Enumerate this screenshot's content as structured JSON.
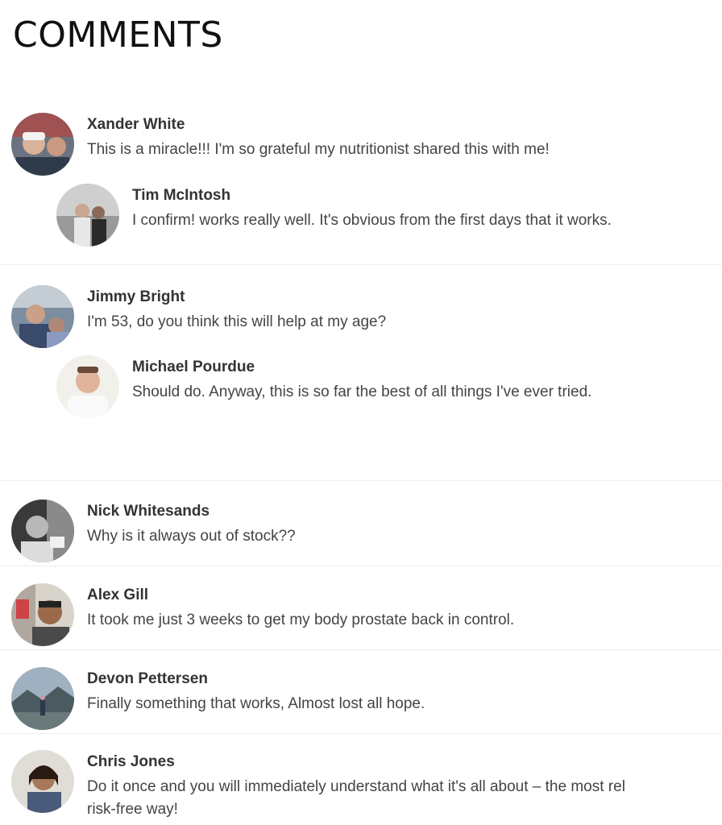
{
  "page": {
    "title": "COMMENTS"
  },
  "comments": [
    {
      "name": "Xander White",
      "text": "This is a miracle!!! I'm so grateful my nutritionist shared this with me!"
    },
    {
      "name": "Tim McIntosh",
      "text": "I confirm! works really well. It's obvious from the first days that it works."
    },
    {
      "name": "Jimmy Bright",
      "text": "I'm 53, do you think this will help at my age?"
    },
    {
      "name": "Michael Pourdue",
      "text": "Should do. Anyway, this is so far the best of all things I've ever tried."
    },
    {
      "name": "Nick Whitesands",
      "text": "Why is it always out of stock??"
    },
    {
      "name": "Alex Gill",
      "text": "It took me just 3 weeks to get my body prostate back in control."
    },
    {
      "name": "Devon Pettersen",
      "text": "Finally something that works, Almost lost all hope."
    },
    {
      "name": "Chris Jones",
      "text": "Do it once and you will immediately understand what it's all about – the most rel",
      "text_line2": "risk-free way!"
    }
  ]
}
